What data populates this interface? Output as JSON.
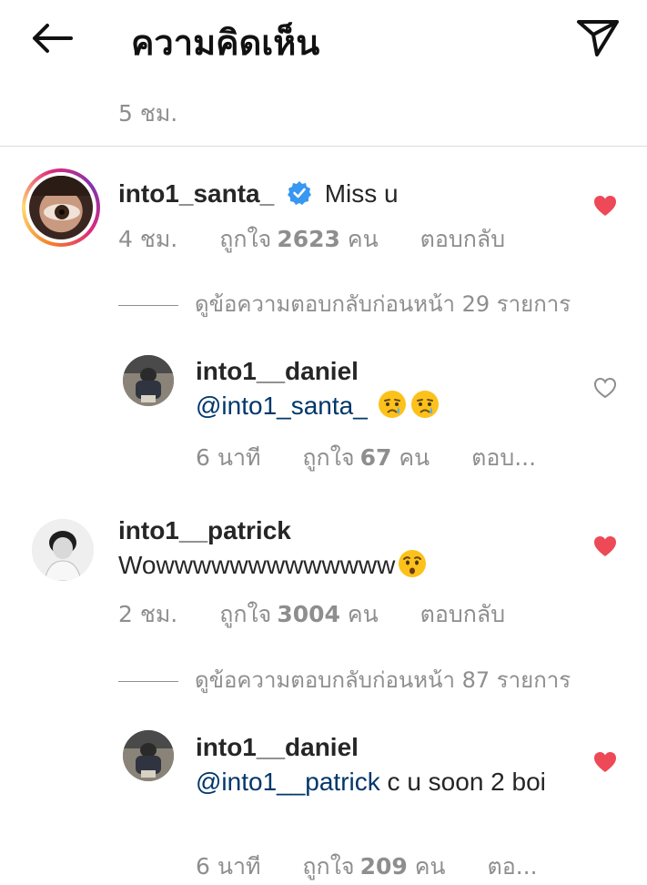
{
  "header": {
    "title": "ความคิดเห็น",
    "back_icon": "arrow-left-icon",
    "share_icon": "paper-plane-icon"
  },
  "caption": {
    "time": "5 ชม."
  },
  "comments": [
    {
      "username": "into1_santa_",
      "verified": true,
      "text": "Miss u",
      "time": "4 ชม.",
      "likes_prefix": "ถูกใจ",
      "likes": "2623",
      "likes_suffix": "คน",
      "reply_label": "ตอบกลับ",
      "liked": true,
      "view_replies": "ดูข้อความตอบกลับก่อนหน้า 29 รายการ",
      "reply": {
        "username": "into1__daniel",
        "mention": "@into1_santa_",
        "emoji": "crying-face-emoji",
        "time": "6 นาที",
        "likes_prefix": "ถูกใจ",
        "likes": "67",
        "likes_suffix": "คน",
        "reply_label": "ตอบ...",
        "liked": false
      }
    },
    {
      "username": "into1__patrick",
      "text": "Wowwwwwwwwwwwww",
      "emoji": "hushed-face-emoji",
      "time": "2 ชม.",
      "likes_prefix": "ถูกใจ",
      "likes": "3004",
      "likes_suffix": "คน",
      "reply_label": "ตอบกลับ",
      "liked": true,
      "view_replies": "ดูข้อความตอบกลับก่อนหน้า 87 รายการ",
      "reply": {
        "username": "into1__daniel",
        "mention": "@into1__patrick",
        "text": " c u soon 2 boi",
        "time": "6 นาที",
        "likes_prefix": "ถูกใจ",
        "likes": "209",
        "likes_suffix": "คน",
        "reply_label": "ตอ...",
        "liked": true
      }
    }
  ],
  "colors": {
    "heart_liked": "#ed4956",
    "mention": "#00376b",
    "muted": "#8e8e8e",
    "verified": "#3897f0"
  }
}
